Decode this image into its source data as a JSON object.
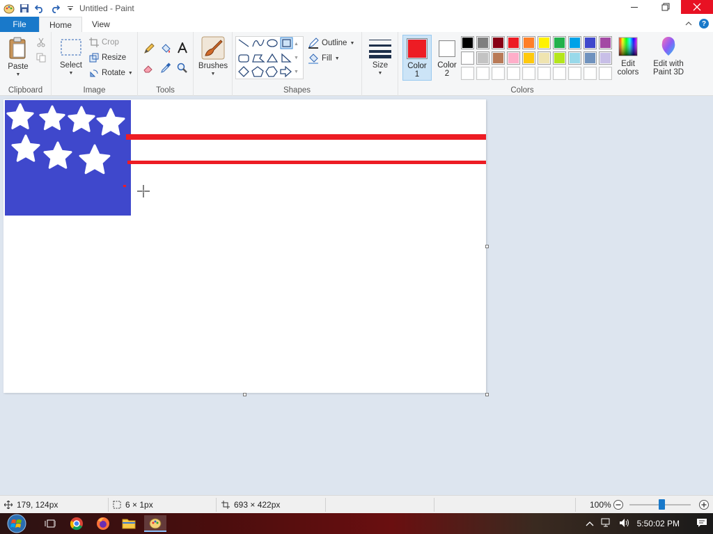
{
  "window": {
    "title": "Untitled - Paint"
  },
  "tabs": {
    "file": "File",
    "home": "Home",
    "view": "View"
  },
  "clipboard": {
    "paste": "Paste",
    "label": "Clipboard"
  },
  "image": {
    "select": "Select",
    "crop": "Crop",
    "resize": "Resize",
    "rotate": "Rotate",
    "label": "Image"
  },
  "tools": {
    "label": "Tools"
  },
  "brushes": {
    "label": "Brushes"
  },
  "shapes": {
    "outline": "Outline",
    "fill": "Fill",
    "label": "Shapes"
  },
  "size": {
    "label": "Size"
  },
  "colors": {
    "color1_label_line1": "Color",
    "color1_label_line2": "1",
    "color2_label_line1": "Color",
    "color2_label_line2": "2",
    "color1_value": "#ed1c24",
    "color2_value": "#ffffff",
    "edit_colors_line1": "Edit",
    "edit_colors_line2": "colors",
    "edit_paint3d_line1": "Edit with",
    "edit_paint3d_line2": "Paint 3D",
    "label": "Colors",
    "palette_row1": [
      "#000000",
      "#7f7f7f",
      "#880015",
      "#ed1c24",
      "#ff7f27",
      "#fff200",
      "#22b14c",
      "#00a2e8",
      "#3f48cc",
      "#a349a4"
    ],
    "palette_row2": [
      "#ffffff",
      "#c3c3c3",
      "#b97a57",
      "#ffaec9",
      "#ffc90e",
      "#efe4b0",
      "#b5e61d",
      "#99d9ea",
      "#7092be",
      "#c8bfe7"
    ],
    "palette_row3": [
      "#ffffff",
      "#ffffff",
      "#ffffff",
      "#ffffff",
      "#ffffff",
      "#ffffff",
      "#ffffff",
      "#ffffff",
      "#ffffff",
      "#ffffff"
    ]
  },
  "drawing": {
    "canton_color": "#3f48cc",
    "stripe_color": "#ed1c24",
    "star_color": "#ffffff"
  },
  "status": {
    "cursor_pos": "179, 124px",
    "selection_size": "6 × 1px",
    "image_size": "693 × 422px",
    "zoom": "100%"
  },
  "taskbar": {
    "time": "5:50:02 PM"
  }
}
